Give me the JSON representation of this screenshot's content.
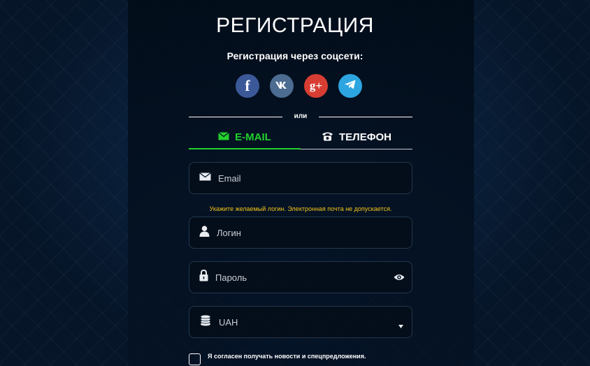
{
  "title": "РЕГИСТРАЦИЯ",
  "social": {
    "caption": "Регистрация через соцсети:",
    "items": [
      {
        "name": "facebook",
        "glyph": "f",
        "color": "#3b5998"
      },
      {
        "name": "vk",
        "glyph": "vk",
        "color": "#4c6c91"
      },
      {
        "name": "google-plus",
        "glyph": "g+",
        "color": "#d73d32"
      },
      {
        "name": "telegram",
        "glyph": "",
        "color": "#2ca5e0"
      }
    ]
  },
  "divider": {
    "text": "или"
  },
  "tabs": [
    {
      "label": "E-MAIL",
      "icon": "envelope-icon",
      "active": true,
      "color": "#22d12c"
    },
    {
      "label": "ТЕЛЕФОН",
      "icon": "phone-icon",
      "active": false,
      "color": "#ffffff"
    }
  ],
  "form": {
    "email": {
      "placeholder": "Email",
      "value": ""
    },
    "login_hint": "Укажите желаемый логин. Электронная почта не допускается.",
    "login": {
      "placeholder": "Логин",
      "value": ""
    },
    "password": {
      "placeholder": "Пароль",
      "value": ""
    },
    "currency": {
      "selected": "UAH"
    },
    "consent": {
      "label": "Я согласен получать новости и спецпредложения.",
      "checked": false
    }
  },
  "colors": {
    "accent": "#22d12c",
    "hint": "#f2c21a",
    "background": "#061528"
  }
}
